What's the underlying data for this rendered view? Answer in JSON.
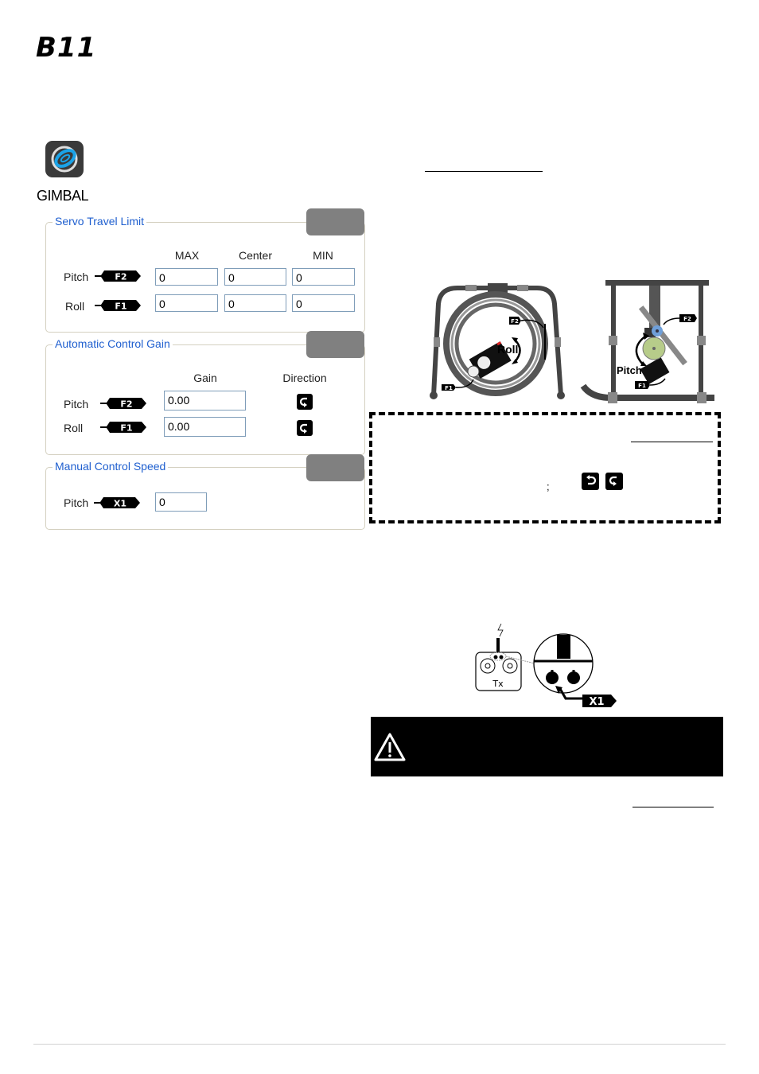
{
  "page": {
    "title": "B11",
    "app_label": "GIMBAL",
    "icon": "gimbal-app-icon"
  },
  "panels": {
    "servo_travel_limit": {
      "legend": "Servo Travel Limit",
      "columns": [
        "MAX",
        "Center",
        "MIN"
      ],
      "rows": [
        {
          "label": "Pitch",
          "tag": "F2",
          "values": [
            "0",
            "0",
            "0"
          ]
        },
        {
          "label": "Roll",
          "tag": "F1",
          "values": [
            "0",
            "0",
            "0"
          ]
        }
      ]
    },
    "automatic_control_gain": {
      "legend": "Automatic Control Gain",
      "columns": [
        "Gain",
        "Direction"
      ],
      "rows": [
        {
          "label": "Pitch",
          "tag": "F2",
          "gain": "0.00",
          "direction_icon": "clockwise-arrow-icon"
        },
        {
          "label": "Roll",
          "tag": "F1",
          "gain": "0.00",
          "direction_icon": "clockwise-arrow-icon"
        }
      ]
    },
    "manual_control_speed": {
      "legend": "Manual Control Speed",
      "rows": [
        {
          "label": "Pitch",
          "tag": "X1",
          "value": "0"
        }
      ]
    }
  },
  "diagrams": {
    "roll": {
      "label": "Roll",
      "tags": [
        "F2",
        "F1"
      ]
    },
    "pitch": {
      "label": "Pitch",
      "tags": [
        "F2",
        "F1"
      ]
    },
    "transmitter": {
      "label": "Tx",
      "tag": "X1"
    }
  },
  "note_box": {
    "separator": ";",
    "icons": [
      "counterclockwise-arrow-icon",
      "clockwise-arrow-icon"
    ]
  },
  "warning": {
    "icon": "warning-triangle-icon"
  },
  "colors": {
    "legend_blue": "#1f5fcf",
    "tab_gray": "#808080",
    "field_border": "#7f9db9",
    "gimbal_green": "#b7cc8a",
    "servo_blue": "#6f9fd8"
  }
}
